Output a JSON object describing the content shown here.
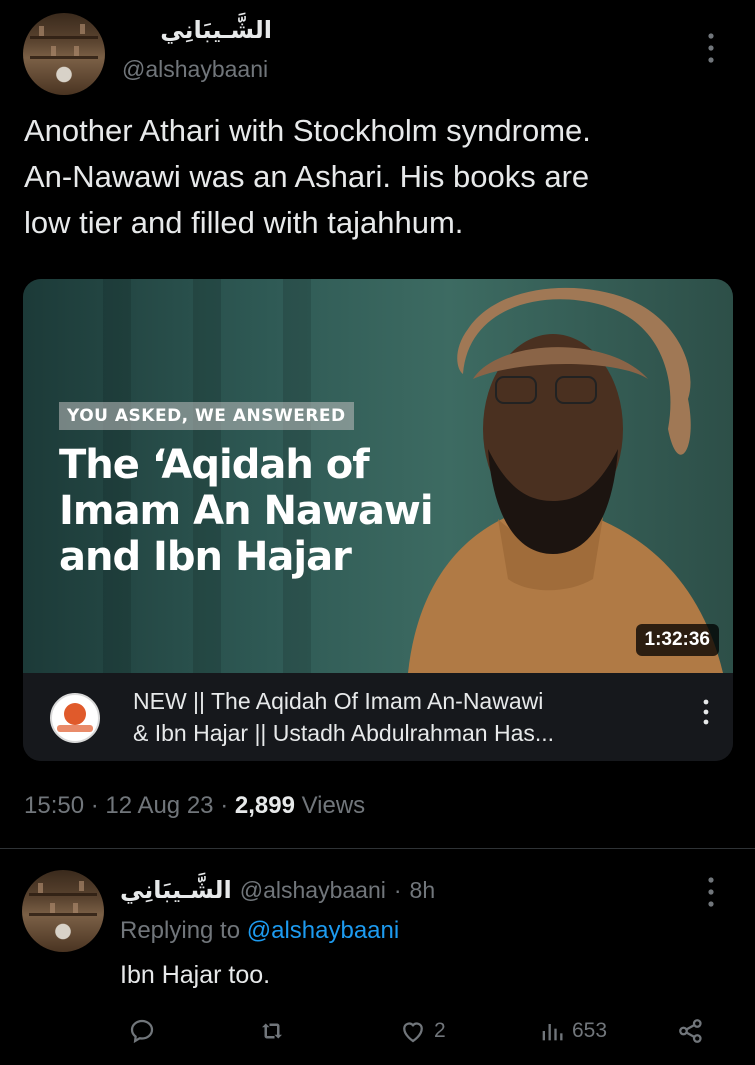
{
  "tweet": {
    "author_name": "الشَّـيبَانِي",
    "author_handle": "@alshaybaani",
    "text_lines": [
      "Another Athari with Stockholm syndrome.",
      "An-Nawawi was an Ashari. His books are",
      "low tier and filled with tajahhum."
    ],
    "card": {
      "pill": "YOU ASKED, WE ANSWERED",
      "title_lines": [
        "The ‘Aqidah of",
        "Imam An Nawawi",
        "and Ibn Hajar"
      ],
      "duration": "1:32:36",
      "caption_lines": [
        "NEW || The Aqidah Of Imam An-Nawawi",
        "& Ibn Hajar || Ustadh Abdulrahman Has..."
      ]
    },
    "time": "15:50",
    "date": "12 Aug 23",
    "views_count": "2,899",
    "views_label": "Views"
  },
  "reply": {
    "author_name": "الشَّـيبَانِي",
    "author_handle": "@alshaybaani",
    "age": "8h",
    "replying_to_label": "Replying to",
    "replying_to_handle": "@alshaybaani",
    "text": "Ibn Hajar too.",
    "actions": {
      "likes": "2",
      "views": "653"
    }
  },
  "colors": {
    "background": "#000000",
    "text": "#e7e9ea",
    "muted": "#71767b",
    "link": "#1d9bf0",
    "divider": "#2f3336"
  },
  "icons": [
    "more-icon",
    "reply-icon",
    "retweet-icon",
    "like-icon",
    "views-icon",
    "share-icon"
  ]
}
